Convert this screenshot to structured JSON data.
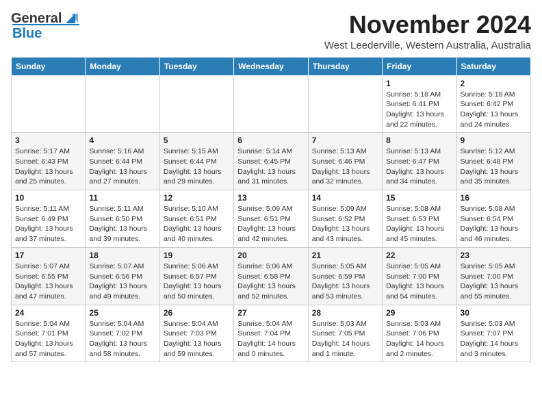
{
  "header": {
    "title": "November 2024",
    "subtitle": "West Leederville, Western Australia, Australia",
    "logo_general": "General",
    "logo_blue": "Blue"
  },
  "calendar": {
    "days_of_week": [
      "Sunday",
      "Monday",
      "Tuesday",
      "Wednesday",
      "Thursday",
      "Friday",
      "Saturday"
    ],
    "weeks": [
      [
        {
          "day": "",
          "info": ""
        },
        {
          "day": "",
          "info": ""
        },
        {
          "day": "",
          "info": ""
        },
        {
          "day": "",
          "info": ""
        },
        {
          "day": "",
          "info": ""
        },
        {
          "day": "1",
          "info": "Sunrise: 5:18 AM\nSunset: 6:41 PM\nDaylight: 13 hours\nand 22 minutes."
        },
        {
          "day": "2",
          "info": "Sunrise: 5:18 AM\nSunset: 6:42 PM\nDaylight: 13 hours\nand 24 minutes."
        }
      ],
      [
        {
          "day": "3",
          "info": "Sunrise: 5:17 AM\nSunset: 6:43 PM\nDaylight: 13 hours\nand 25 minutes."
        },
        {
          "day": "4",
          "info": "Sunrise: 5:16 AM\nSunset: 6:44 PM\nDaylight: 13 hours\nand 27 minutes."
        },
        {
          "day": "5",
          "info": "Sunrise: 5:15 AM\nSunset: 6:44 PM\nDaylight: 13 hours\nand 29 minutes."
        },
        {
          "day": "6",
          "info": "Sunrise: 5:14 AM\nSunset: 6:45 PM\nDaylight: 13 hours\nand 31 minutes."
        },
        {
          "day": "7",
          "info": "Sunrise: 5:13 AM\nSunset: 6:46 PM\nDaylight: 13 hours\nand 32 minutes."
        },
        {
          "day": "8",
          "info": "Sunrise: 5:13 AM\nSunset: 6:47 PM\nDaylight: 13 hours\nand 34 minutes."
        },
        {
          "day": "9",
          "info": "Sunrise: 5:12 AM\nSunset: 6:48 PM\nDaylight: 13 hours\nand 35 minutes."
        }
      ],
      [
        {
          "day": "10",
          "info": "Sunrise: 5:11 AM\nSunset: 6:49 PM\nDaylight: 13 hours\nand 37 minutes."
        },
        {
          "day": "11",
          "info": "Sunrise: 5:11 AM\nSunset: 6:50 PM\nDaylight: 13 hours\nand 39 minutes."
        },
        {
          "day": "12",
          "info": "Sunrise: 5:10 AM\nSunset: 6:51 PM\nDaylight: 13 hours\nand 40 minutes."
        },
        {
          "day": "13",
          "info": "Sunrise: 5:09 AM\nSunset: 6:51 PM\nDaylight: 13 hours\nand 42 minutes."
        },
        {
          "day": "14",
          "info": "Sunrise: 5:09 AM\nSunset: 6:52 PM\nDaylight: 13 hours\nand 43 minutes."
        },
        {
          "day": "15",
          "info": "Sunrise: 5:08 AM\nSunset: 6:53 PM\nDaylight: 13 hours\nand 45 minutes."
        },
        {
          "day": "16",
          "info": "Sunrise: 5:08 AM\nSunset: 6:54 PM\nDaylight: 13 hours\nand 46 minutes."
        }
      ],
      [
        {
          "day": "17",
          "info": "Sunrise: 5:07 AM\nSunset: 6:55 PM\nDaylight: 13 hours\nand 47 minutes."
        },
        {
          "day": "18",
          "info": "Sunrise: 5:07 AM\nSunset: 6:56 PM\nDaylight: 13 hours\nand 49 minutes."
        },
        {
          "day": "19",
          "info": "Sunrise: 5:06 AM\nSunset: 6:57 PM\nDaylight: 13 hours\nand 50 minutes."
        },
        {
          "day": "20",
          "info": "Sunrise: 5:06 AM\nSunset: 6:58 PM\nDaylight: 13 hours\nand 52 minutes."
        },
        {
          "day": "21",
          "info": "Sunrise: 5:05 AM\nSunset: 6:59 PM\nDaylight: 13 hours\nand 53 minutes."
        },
        {
          "day": "22",
          "info": "Sunrise: 5:05 AM\nSunset: 7:00 PM\nDaylight: 13 hours\nand 54 minutes."
        },
        {
          "day": "23",
          "info": "Sunrise: 5:05 AM\nSunset: 7:00 PM\nDaylight: 13 hours\nand 55 minutes."
        }
      ],
      [
        {
          "day": "24",
          "info": "Sunrise: 5:04 AM\nSunset: 7:01 PM\nDaylight: 13 hours\nand 57 minutes."
        },
        {
          "day": "25",
          "info": "Sunrise: 5:04 AM\nSunset: 7:02 PM\nDaylight: 13 hours\nand 58 minutes."
        },
        {
          "day": "26",
          "info": "Sunrise: 5:04 AM\nSunset: 7:03 PM\nDaylight: 13 hours\nand 59 minutes."
        },
        {
          "day": "27",
          "info": "Sunrise: 5:04 AM\nSunset: 7:04 PM\nDaylight: 14 hours\nand 0 minutes."
        },
        {
          "day": "28",
          "info": "Sunrise: 5:03 AM\nSunset: 7:05 PM\nDaylight: 14 hours\nand 1 minute."
        },
        {
          "day": "29",
          "info": "Sunrise: 5:03 AM\nSunset: 7:06 PM\nDaylight: 14 hours\nand 2 minutes."
        },
        {
          "day": "30",
          "info": "Sunrise: 5:03 AM\nSunset: 7:07 PM\nDaylight: 14 hours\nand 3 minutes."
        }
      ]
    ]
  }
}
